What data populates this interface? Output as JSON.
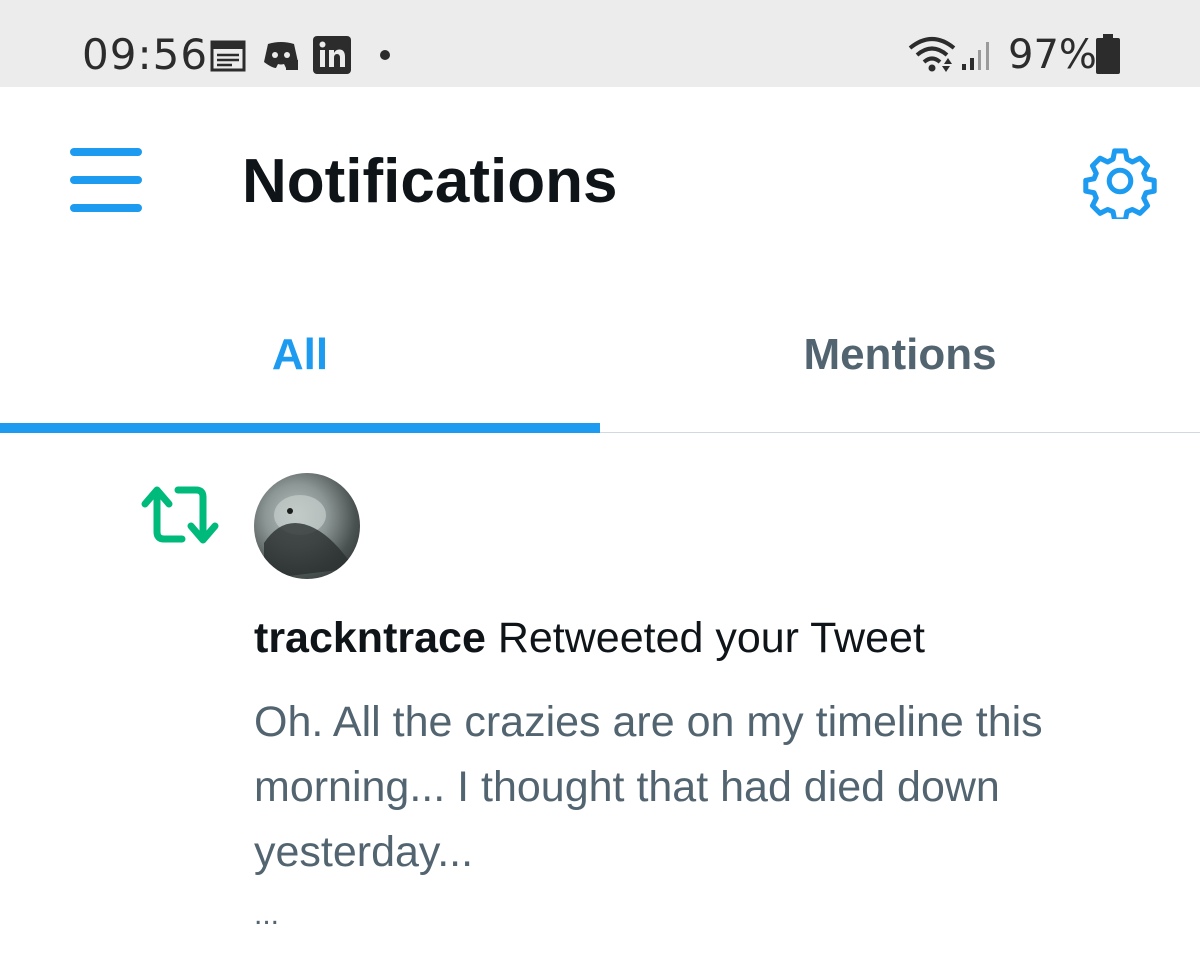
{
  "status_bar": {
    "time": "09:56",
    "battery": "97%",
    "notification_icons": [
      "calendar-icon",
      "discord-icon",
      "linkedin-icon",
      "dot-icon"
    ],
    "system_icons": [
      "wifi-icon",
      "signal-icon",
      "battery-icon"
    ]
  },
  "header": {
    "title": "Notifications",
    "menu_icon": "hamburger-menu-icon",
    "settings_icon": "gear-icon"
  },
  "tabs": [
    {
      "label": "All",
      "selected": true
    },
    {
      "label": "Mentions",
      "selected": false
    }
  ],
  "notification": {
    "type_icon": "retweet-icon",
    "username": "trackntrace",
    "action": "Retweeted your Tweet",
    "tweet_text": "Oh. All the crazies are on my timeline this morning... I thought that had died down yesterday...",
    "more": "..."
  },
  "colors": {
    "accent": "#1d9bf0",
    "retweet": "#00ba7c",
    "secondary_text": "#536471",
    "primary_text": "#0f1419",
    "status_bar_bg": "#ececec"
  }
}
